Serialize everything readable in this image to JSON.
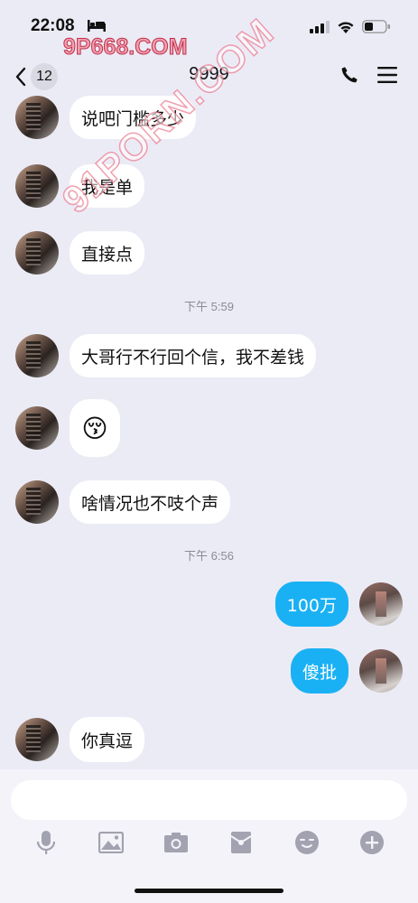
{
  "status_bar": {
    "time": "22:08"
  },
  "watermarks": {
    "top": "9P668.COM",
    "diagonal": "91PORN.COM"
  },
  "nav": {
    "unread_count": "12",
    "title": "9999"
  },
  "messages": [
    {
      "side": "left",
      "text": "说吧门槛多少"
    },
    {
      "side": "left",
      "text": "我是单"
    },
    {
      "side": "left",
      "text": "直接点"
    },
    {
      "side": "left",
      "text": "大哥行不行回个信，我不差钱"
    },
    {
      "side": "left",
      "text": "😚"
    },
    {
      "side": "left",
      "text": "啥情况也不吱个声"
    },
    {
      "side": "right",
      "text": "100万"
    },
    {
      "side": "right",
      "text": "傻批"
    },
    {
      "side": "left",
      "text": "你真逗"
    }
  ],
  "timestamps": [
    "下午 5:59",
    "下午 6:56"
  ],
  "input": {
    "placeholder": ""
  },
  "toolbar_icons": [
    "microphone-icon",
    "image-icon",
    "camera-icon",
    "red-packet-icon",
    "emoji-icon",
    "plus-icon"
  ],
  "colors": {
    "background": "#ebebf6",
    "bubble_self": "#1ab1f4",
    "bubble_other": "#ffffff",
    "icon_gray": "#a2a2b0"
  }
}
